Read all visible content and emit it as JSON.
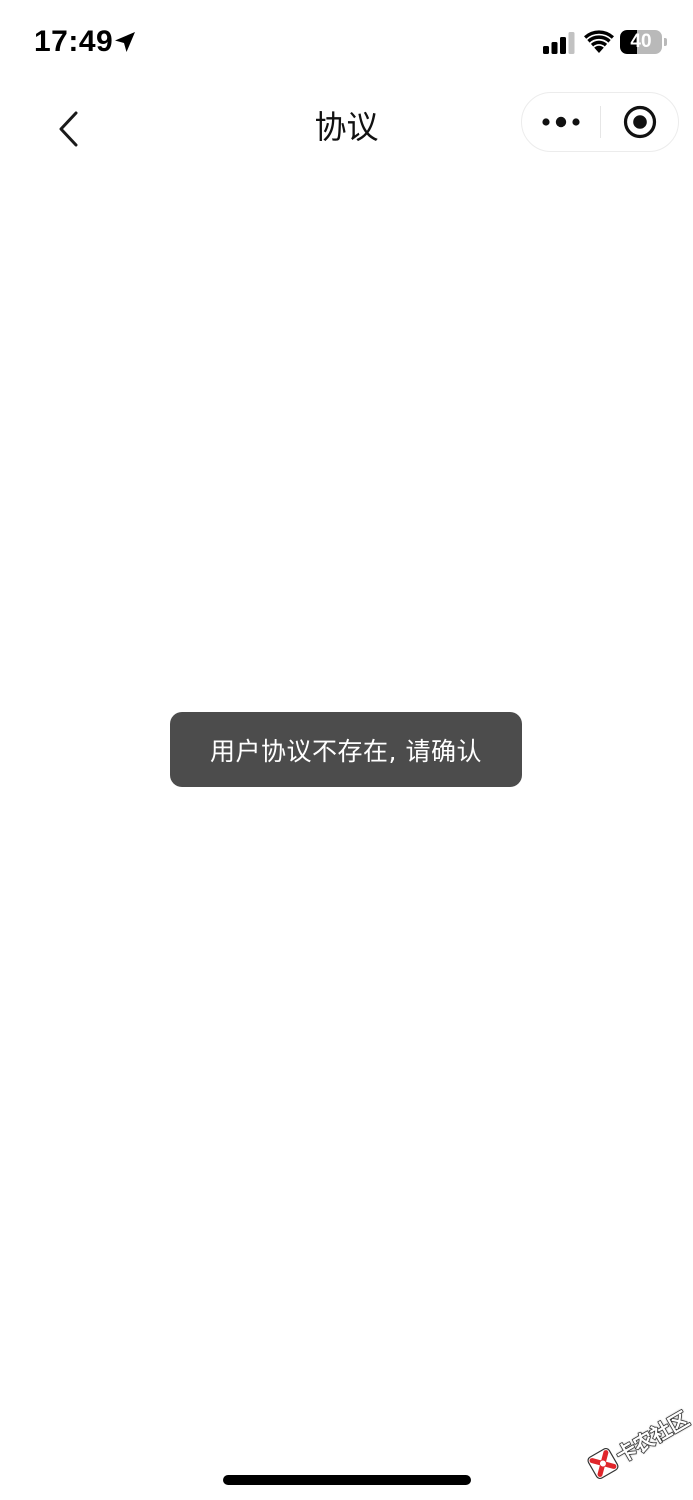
{
  "status_bar": {
    "time": "17:49",
    "battery_level": "40",
    "battery_fraction": 0.4,
    "icons": [
      "location-arrow-icon",
      "cellular-signal-icon",
      "wifi-icon",
      "battery-icon"
    ]
  },
  "nav": {
    "title": "协议",
    "back_icon": "chevron-left-icon",
    "more_icon": "more-dots-icon",
    "close_icon": "target-close-icon"
  },
  "toast": {
    "message": "用户协议不存在, 请确认"
  },
  "watermark": {
    "text": "卡农社区"
  },
  "colors": {
    "toast_background": "#4c4c4c",
    "watermark_red": "#e0262b"
  }
}
